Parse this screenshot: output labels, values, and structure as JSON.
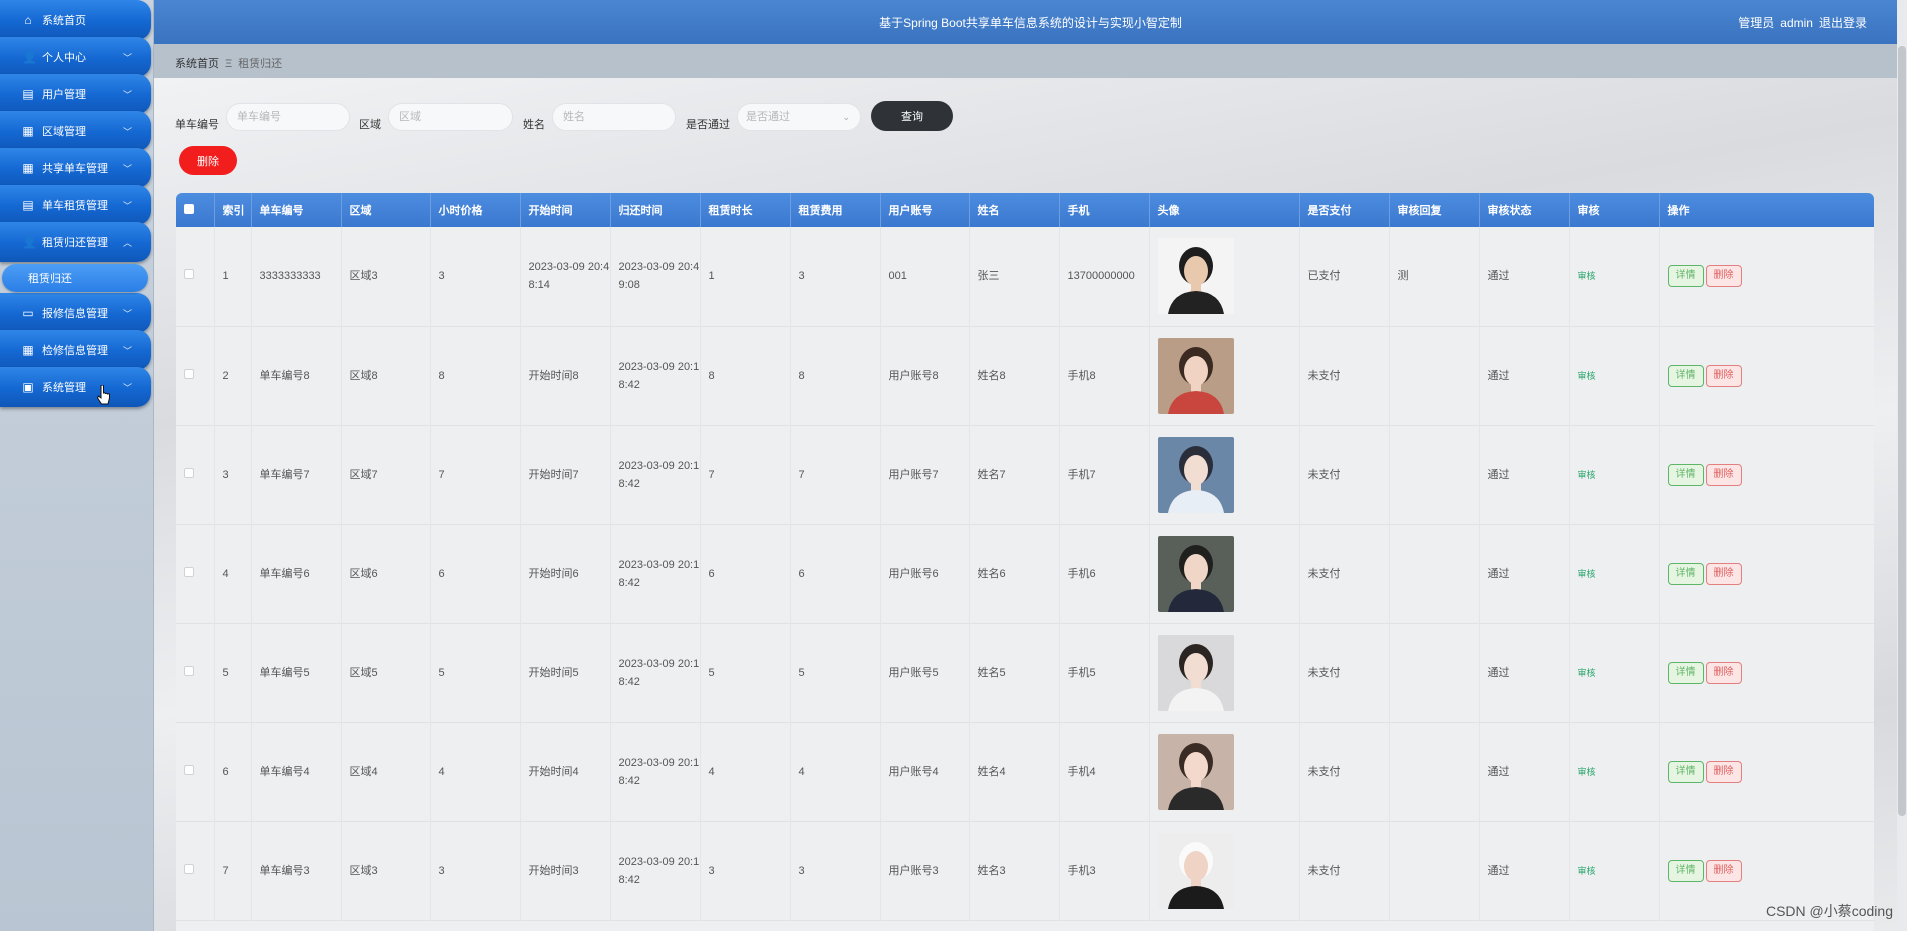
{
  "sidebar": {
    "items": [
      {
        "label": "系统首页",
        "icon": "home-icon",
        "glyph": "⌂",
        "chevron": false
      },
      {
        "label": "个人中心",
        "icon": "user-icon",
        "glyph": "👤",
        "chevron": true
      },
      {
        "label": "用户管理",
        "icon": "clipboard-icon",
        "glyph": "▤",
        "chevron": true
      },
      {
        "label": "区域管理",
        "icon": "grid-icon",
        "glyph": "▦",
        "chevron": true
      },
      {
        "label": "共享单车管理",
        "icon": "grid-icon",
        "glyph": "▦",
        "chevron": true
      },
      {
        "label": "单车租赁管理",
        "icon": "list-icon",
        "glyph": "▤",
        "chevron": true
      },
      {
        "label": "租赁归还管理",
        "icon": "user-icon",
        "glyph": "👤",
        "chevron": true,
        "expanded": true
      },
      {
        "label": "报修信息管理",
        "icon": "monitor-icon",
        "glyph": "▭",
        "chevron": true
      },
      {
        "label": "检修信息管理",
        "icon": "grid-icon",
        "glyph": "▦",
        "chevron": true
      },
      {
        "label": "系统管理",
        "icon": "settings-icon",
        "glyph": "▣",
        "chevron": true
      }
    ],
    "subitem": {
      "label": "租赁归还"
    }
  },
  "header": {
    "title": "基于Spring Boot共享单车信息系统的设计与实现小智定制",
    "user_role": "管理员",
    "username": "admin",
    "logout": "退出登录"
  },
  "breadcrumb": {
    "home": "系统首页",
    "separator": "Ξ",
    "current": "租赁归还"
  },
  "search": {
    "bike_no_label": "单车编号",
    "bike_no_placeholder": "单车编号",
    "area_label": "区域",
    "area_placeholder": "区域",
    "name_label": "姓名",
    "name_placeholder": "姓名",
    "pass_label": "是否通过",
    "pass_placeholder": "是否通过",
    "query_button": "查询",
    "delete_button": "删除"
  },
  "table": {
    "columns": [
      "索引",
      "单车编号",
      "区域",
      "小时价格",
      "开始时间",
      "归还时间",
      "租赁时长",
      "租赁费用",
      "用户账号",
      "姓名",
      "手机",
      "头像",
      "是否支付",
      "审核回复",
      "审核状态",
      "审核",
      "操作"
    ],
    "audit_link": "审核",
    "detail_button": "详情",
    "row_delete_button": "删除",
    "rows": [
      {
        "index": "1",
        "bike_no": "3333333333",
        "area": "区域3",
        "price": "3",
        "start": "2023-03-09 20:48:14",
        "return": "2023-03-09 20:49:08",
        "duration": "1",
        "fee": "3",
        "account": "001",
        "name": "张三",
        "phone": "13700000000",
        "paid": "已支付",
        "reply": "测",
        "status": "通过"
      },
      {
        "index": "2",
        "bike_no": "单车编号8",
        "area": "区域8",
        "price": "8",
        "start": "开始时间8",
        "return": "2023-03-09 20:18:42",
        "duration": "8",
        "fee": "8",
        "account": "用户账号8",
        "name": "姓名8",
        "phone": "手机8",
        "paid": "未支付",
        "reply": "",
        "status": "通过"
      },
      {
        "index": "3",
        "bike_no": "单车编号7",
        "area": "区域7",
        "price": "7",
        "start": "开始时间7",
        "return": "2023-03-09 20:18:42",
        "duration": "7",
        "fee": "7",
        "account": "用户账号7",
        "name": "姓名7",
        "phone": "手机7",
        "paid": "未支付",
        "reply": "",
        "status": "通过"
      },
      {
        "index": "4",
        "bike_no": "单车编号6",
        "area": "区域6",
        "price": "6",
        "start": "开始时间6",
        "return": "2023-03-09 20:18:42",
        "duration": "6",
        "fee": "6",
        "account": "用户账号6",
        "name": "姓名6",
        "phone": "手机6",
        "paid": "未支付",
        "reply": "",
        "status": "通过"
      },
      {
        "index": "5",
        "bike_no": "单车编号5",
        "area": "区域5",
        "price": "5",
        "start": "开始时间5",
        "return": "2023-03-09 20:18:42",
        "duration": "5",
        "fee": "5",
        "account": "用户账号5",
        "name": "姓名5",
        "phone": "手机5",
        "paid": "未支付",
        "reply": "",
        "status": "通过"
      },
      {
        "index": "6",
        "bike_no": "单车编号4",
        "area": "区域4",
        "price": "4",
        "start": "开始时间4",
        "return": "2023-03-09 20:18:42",
        "duration": "4",
        "fee": "4",
        "account": "用户账号4",
        "name": "姓名4",
        "phone": "手机4",
        "paid": "未支付",
        "reply": "",
        "status": "通过"
      },
      {
        "index": "7",
        "bike_no": "单车编号3",
        "area": "区域3",
        "price": "3",
        "start": "开始时间3",
        "return": "2023-03-09 20:18:42",
        "duration": "3",
        "fee": "3",
        "account": "用户账号3",
        "name": "姓名3",
        "phone": "手机3",
        "paid": "未支付",
        "reply": "",
        "status": "通过"
      }
    ]
  },
  "watermark": "CSDN @小蔡coding",
  "colors": {
    "header_blue": "#3a78cf",
    "sidebar_blue": "#1467d2",
    "delete_red": "#f21d1d",
    "query_dark": "#2f3338",
    "audit_green": "#2aa56d"
  }
}
